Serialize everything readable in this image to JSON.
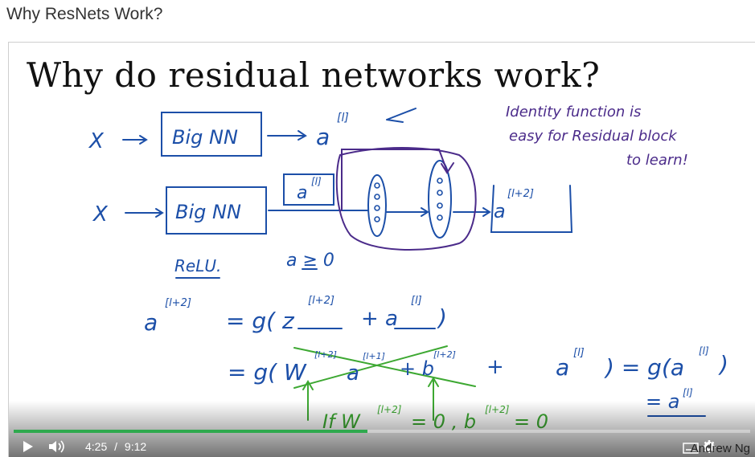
{
  "page": {
    "title": "Why ResNets Work?"
  },
  "slide": {
    "title": "Why do residual networks work?",
    "handwriting": {
      "x1": "X",
      "x2": "X",
      "box1": "Big NN",
      "box2": "Big NN",
      "a_l": "a",
      "sup_l": "[l]",
      "a_in": "a",
      "sup_in": "[l]",
      "a_out": "a",
      "sup_out": "[l+2]",
      "note1": "Identity function is",
      "note2": "easy for Residual block",
      "note3": "to learn!",
      "relu": "ReLU.",
      "cond": "a ≥ 0",
      "eq1_lhs": "a",
      "eq1_lhs_sup": "[l+2]",
      "eq1_rhs": "= g( z",
      "eq1_z_sup": "[l+2]",
      "eq1_plus": "+ a",
      "eq1_a_sup": "[l]",
      "eq1_close": ")",
      "eq2_start": "= g( W",
      "eq2_w_sup": "[l+2]",
      "eq2_a": "a",
      "eq2_a_sup": "[l+1]",
      "eq2_b": "+ b",
      "eq2_b_sup": "[l+2]",
      "eq2_plus": "+",
      "eq2_al": "a",
      "eq2_al_sup": "[l]",
      "eq2_result": ") = g(a",
      "eq2_result_sup": "[l]",
      "eq2_result_close": ")",
      "eq3": "= a",
      "eq3_sup": "[l]",
      "cond2_if": "If W",
      "cond2_w_sup": "[l+2]",
      "cond2_mid": "= 0 , b",
      "cond2_b_sup": "[l+2]",
      "cond2_end": "= 0"
    }
  },
  "player": {
    "time_current": "4:25",
    "time_separator": "/",
    "time_total": "9:12",
    "progress_fraction": 0.48,
    "watermark": "Andrew Ng",
    "accent": "#2fa94e",
    "icons": [
      "play-icon",
      "volume-icon",
      "captions-icon",
      "settings-icon"
    ]
  },
  "colors": {
    "ink_blue": "#1c4fa8",
    "ink_green": "#3da832",
    "ink_purple": "#4b2b8a"
  }
}
